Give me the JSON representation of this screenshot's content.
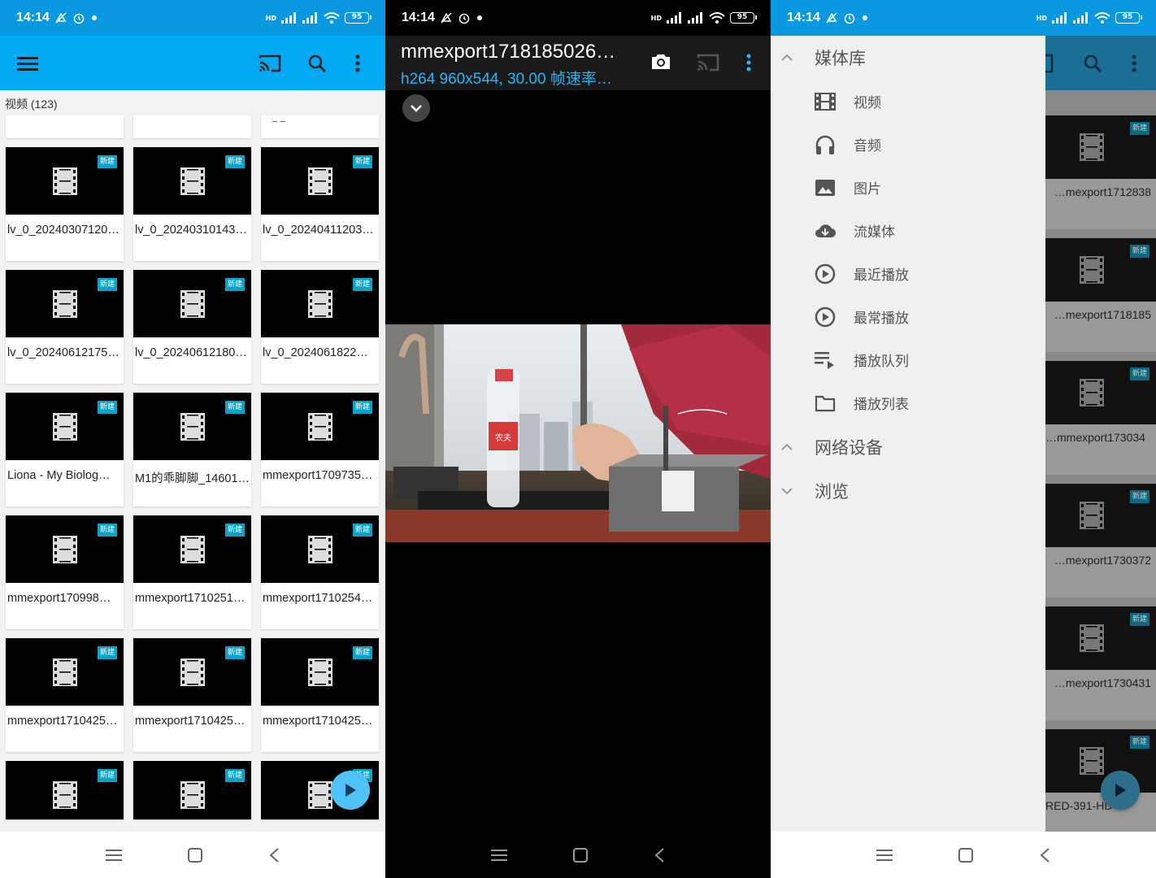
{
  "status": {
    "time": "14:14",
    "battery": "95",
    "hd": "HD"
  },
  "library": {
    "section_label": "视频 (123)",
    "new_badge": "新建",
    "top_partial": "_ _",
    "videos": [
      "lv_0_20240307120…",
      "lv_0_20240310143…",
      "lv_0_20240411203…",
      "lv_0_20240612175…",
      "lv_0_20240612180…",
      "lv_0_2024061822…",
      "Liona - My Biolog…",
      "M1的乖脚脚_14601…",
      "mmexport1709735…",
      "mmexport170998…",
      "mmexport1710251…",
      "mmexport1710254…",
      "mmexport1710425…",
      "mmexport1710425…",
      "mmexport1710425…",
      "",
      "",
      ""
    ]
  },
  "player": {
    "title": "mmexport1718185026…",
    "subtitle": "h264 960x544, 30.00 帧速率…",
    "bottle_text": "农夫"
  },
  "drawer": {
    "media_library": "媒体库",
    "items": [
      "视频",
      "音频",
      "图片",
      "流媒体",
      "最近播放",
      "最常播放",
      "播放队列",
      "播放列表"
    ],
    "network": "网络设备",
    "browse": "浏览"
  },
  "background_list": {
    "new_badge": "新建",
    "names": [
      "mmexport1712838…",
      "mmexport1718185…",
      "mmexport173034…",
      "mmexport1730372…",
      "mmexport1730431…",
      "RED-391-HD"
    ]
  }
}
